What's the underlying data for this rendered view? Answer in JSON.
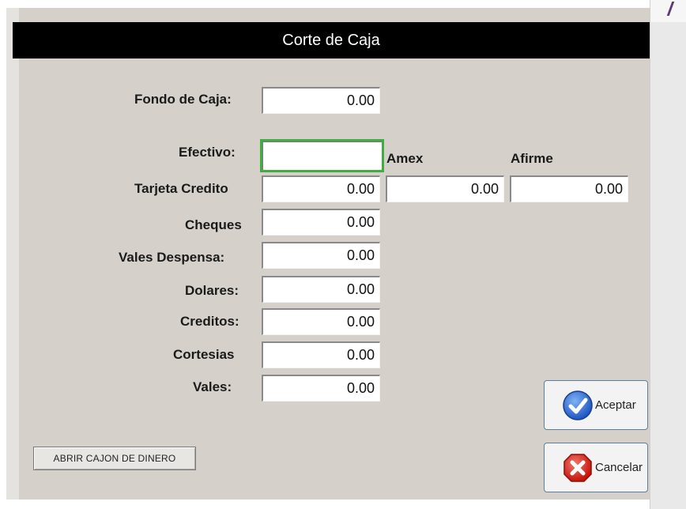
{
  "dialog": {
    "title": "Corte de Caja"
  },
  "fields": {
    "fondo": {
      "label": "Fondo de Caja:",
      "value": "0.00"
    },
    "efectivo": {
      "label": "Efectivo:",
      "value": ""
    },
    "tarjeta": {
      "label": "Tarjeta Credito",
      "value": "0.00"
    },
    "amex": {
      "label": "Amex",
      "value": "0.00"
    },
    "afirme": {
      "label": "Afirme",
      "value": "0.00"
    },
    "cheques": {
      "label": "Cheques",
      "value": "0.00"
    },
    "vales_despensa": {
      "label": "Vales Despensa:",
      "value": "0.00"
    },
    "dolares": {
      "label": "Dolares:",
      "value": "0.00"
    },
    "creditos": {
      "label": "Creditos:",
      "value": "0.00"
    },
    "cortesias": {
      "label": "Cortesias",
      "value": "0.00"
    },
    "vales": {
      "label": "Vales:",
      "value": "0.00"
    }
  },
  "buttons": {
    "open_drawer": "ABRIR CAJON DE DINERO",
    "accept": "Aceptar",
    "cancel": "Cancelar"
  },
  "icons": {
    "accept": "check-circle-icon",
    "cancel": "x-cross-icon",
    "corner": "document-icon"
  },
  "colors": {
    "titlebar": "#000000",
    "dialog_bg": "#d5d1ca",
    "focus_border": "#3fae3f",
    "accept_icon": "#2e6fd8",
    "cancel_icon": "#d9261c"
  }
}
